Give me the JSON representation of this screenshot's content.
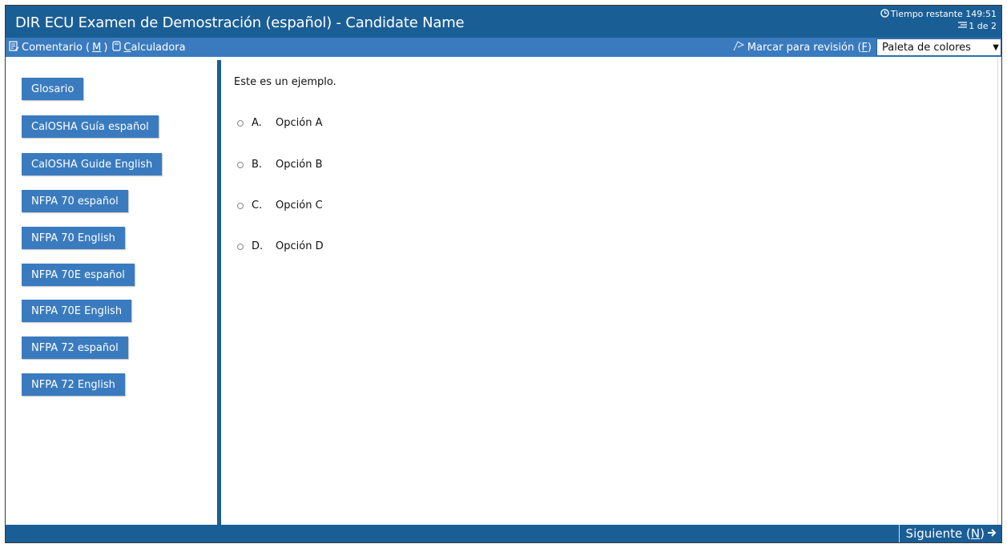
{
  "header": {
    "title": "DIR ECU Examen de Demostración (español) - Candidate Name",
    "timer_label": "Tiempo restante 149:51",
    "progress": "1 de 2"
  },
  "toolbar": {
    "comment_pre": "Comentario (",
    "comment_key": "M",
    "comment_post": ")",
    "calc_key": "C",
    "calc_rest": "alculadora",
    "mark_label": "Marcar para revisión (",
    "mark_key": "F",
    "mark_post": ")",
    "palette_label": "Paleta de colores"
  },
  "sidebar": {
    "items": [
      {
        "label": "Glosario"
      },
      {
        "label": "CalOSHA Guía español"
      },
      {
        "label": "CalOSHA Guide English"
      },
      {
        "label": "NFPA 70 español"
      },
      {
        "label": "NFPA 70 English"
      },
      {
        "label": "NFPA 70E español"
      },
      {
        "label": "NFPA 70E English"
      },
      {
        "label": "NFPA 72 español"
      },
      {
        "label": "NFPA 72 English"
      }
    ]
  },
  "question": {
    "stem": "Este es un ejemplo.",
    "options": [
      {
        "letter": "A.",
        "text": "Opción A"
      },
      {
        "letter": "B.",
        "text": "Opción B"
      },
      {
        "letter": "C.",
        "text": "Opción C"
      },
      {
        "letter": "D.",
        "text": "Opción D"
      }
    ]
  },
  "footer": {
    "next_pre": "Siguiente (",
    "next_key": "N",
    "next_post": ")"
  },
  "colors": {
    "header_bg": "#1a5e96",
    "toolbar_bg": "#3a7bbf",
    "button_bg": "#3a7bbf"
  }
}
